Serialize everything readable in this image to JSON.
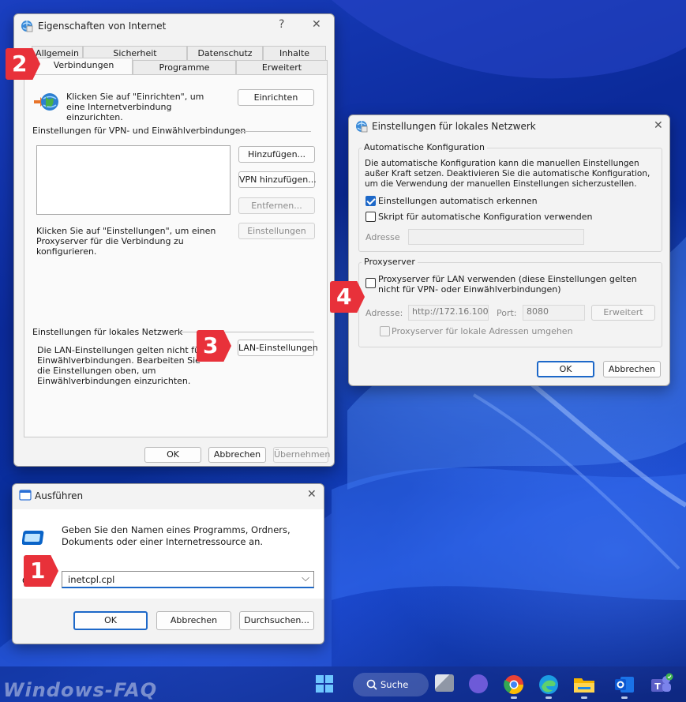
{
  "colors": {
    "accent": "#1d68c8",
    "badge": "#e8313a",
    "wallpaper": "#0b2a9a"
  },
  "internet_options": {
    "title": "Eigenschaften von Internet",
    "help": "?",
    "close": "✕",
    "tabs_row1": [
      "Allgemein",
      "Sicherheit",
      "Datenschutz",
      "Inhalte"
    ],
    "tabs_row2": [
      "Verbindungen",
      "Programme",
      "Erweitert"
    ],
    "setup_text": "Klicken Sie auf \"Einrichten\", um eine Internetverbindung einzurichten.",
    "setup_button": "Einrichten",
    "vpn_group": "Einstellungen für VPN- und Einwählverbindungen",
    "add_button": "Hinzufügen...",
    "add_vpn_button": "VPN hinzufügen...",
    "remove_button": "Entfernen...",
    "settings_text": "Klicken Sie auf \"Einstellungen\", um einen Proxyserver für die Verbindung zu konfigurieren.",
    "settings_button": "Einstellungen",
    "lan_group": "Einstellungen für lokales Netzwerk",
    "lan_text": "Die LAN-Einstellungen gelten nicht für Einwählverbindungen. Bearbeiten Sie die Einstellungen oben, um Einwählverbindungen einzurichten.",
    "lan_button": "LAN-Einstellungen",
    "ok": "OK",
    "cancel": "Abbrechen",
    "apply": "Übernehmen"
  },
  "lan_settings": {
    "title": "Einstellungen für lokales Netzwerk",
    "close": "✕",
    "auto_group": "Automatische Konfiguration",
    "auto_text": "Die automatische Konfiguration kann die manuellen Einstellungen außer Kraft setzen. Deaktivieren Sie die automatische Konfiguration, um die Verwendung der manuellen Einstellungen sicherzustellen.",
    "auto_detect": "Einstellungen automatisch erkennen",
    "auto_detect_checked": true,
    "auto_script": "Skript für automatische Konfiguration verwenden",
    "auto_script_checked": false,
    "address_label": "Adresse",
    "proxy_group": "Proxyserver",
    "use_proxy": "Proxyserver für LAN verwenden (diese Einstellungen gelten nicht für VPN- oder Einwählverbindungen)",
    "use_proxy_checked": false,
    "proxy_address_label": "Adresse:",
    "proxy_address_value": "http://172.16.100.",
    "port_label": "Port:",
    "port_value": "8080",
    "advanced_button": "Erweitert",
    "bypass_local": "Proxyserver für lokale Adressen umgehen",
    "ok": "OK",
    "cancel": "Abbrechen"
  },
  "run_dialog": {
    "title": "Ausführen",
    "close": "✕",
    "description": "Geben Sie den Namen eines Programms, Ordners, Dokuments oder einer Internetressource an.",
    "open_label": "Ö",
    "command_value": "inetcpl.cpl",
    "ok": "OK",
    "cancel": "Abbrechen",
    "browse": "Durchsuchen..."
  },
  "badges": [
    "1",
    "2",
    "3",
    "4"
  ],
  "taskbar": {
    "search_label": "Suche"
  },
  "watermark": "Windows-FAQ"
}
